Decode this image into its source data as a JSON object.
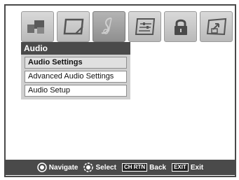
{
  "icon_bar": {
    "tiles": [
      {
        "icon": "picture-icon",
        "selected": false
      },
      {
        "icon": "screen-icon",
        "selected": false
      },
      {
        "icon": "audio-icon",
        "selected": true
      },
      {
        "icon": "setup-icon",
        "selected": false
      },
      {
        "icon": "lock-icon",
        "selected": false
      },
      {
        "icon": "applications-icon",
        "selected": false
      }
    ]
  },
  "panel": {
    "title": "Audio",
    "items": [
      {
        "label": "Audio Settings",
        "active": true
      },
      {
        "label": "Advanced Audio Settings",
        "active": false
      },
      {
        "label": "Audio Setup",
        "active": false
      }
    ]
  },
  "footer": {
    "navigate_label": "Navigate",
    "select_label": "Select",
    "back_key": "CH RTN",
    "back_label": "Back",
    "exit_key": "EXIT",
    "exit_label": "Exit"
  },
  "colors": {
    "header_bg": "#4a4a4a",
    "menu_bg": "#cfcfcf",
    "tile_bg": "#c8c8c8"
  }
}
